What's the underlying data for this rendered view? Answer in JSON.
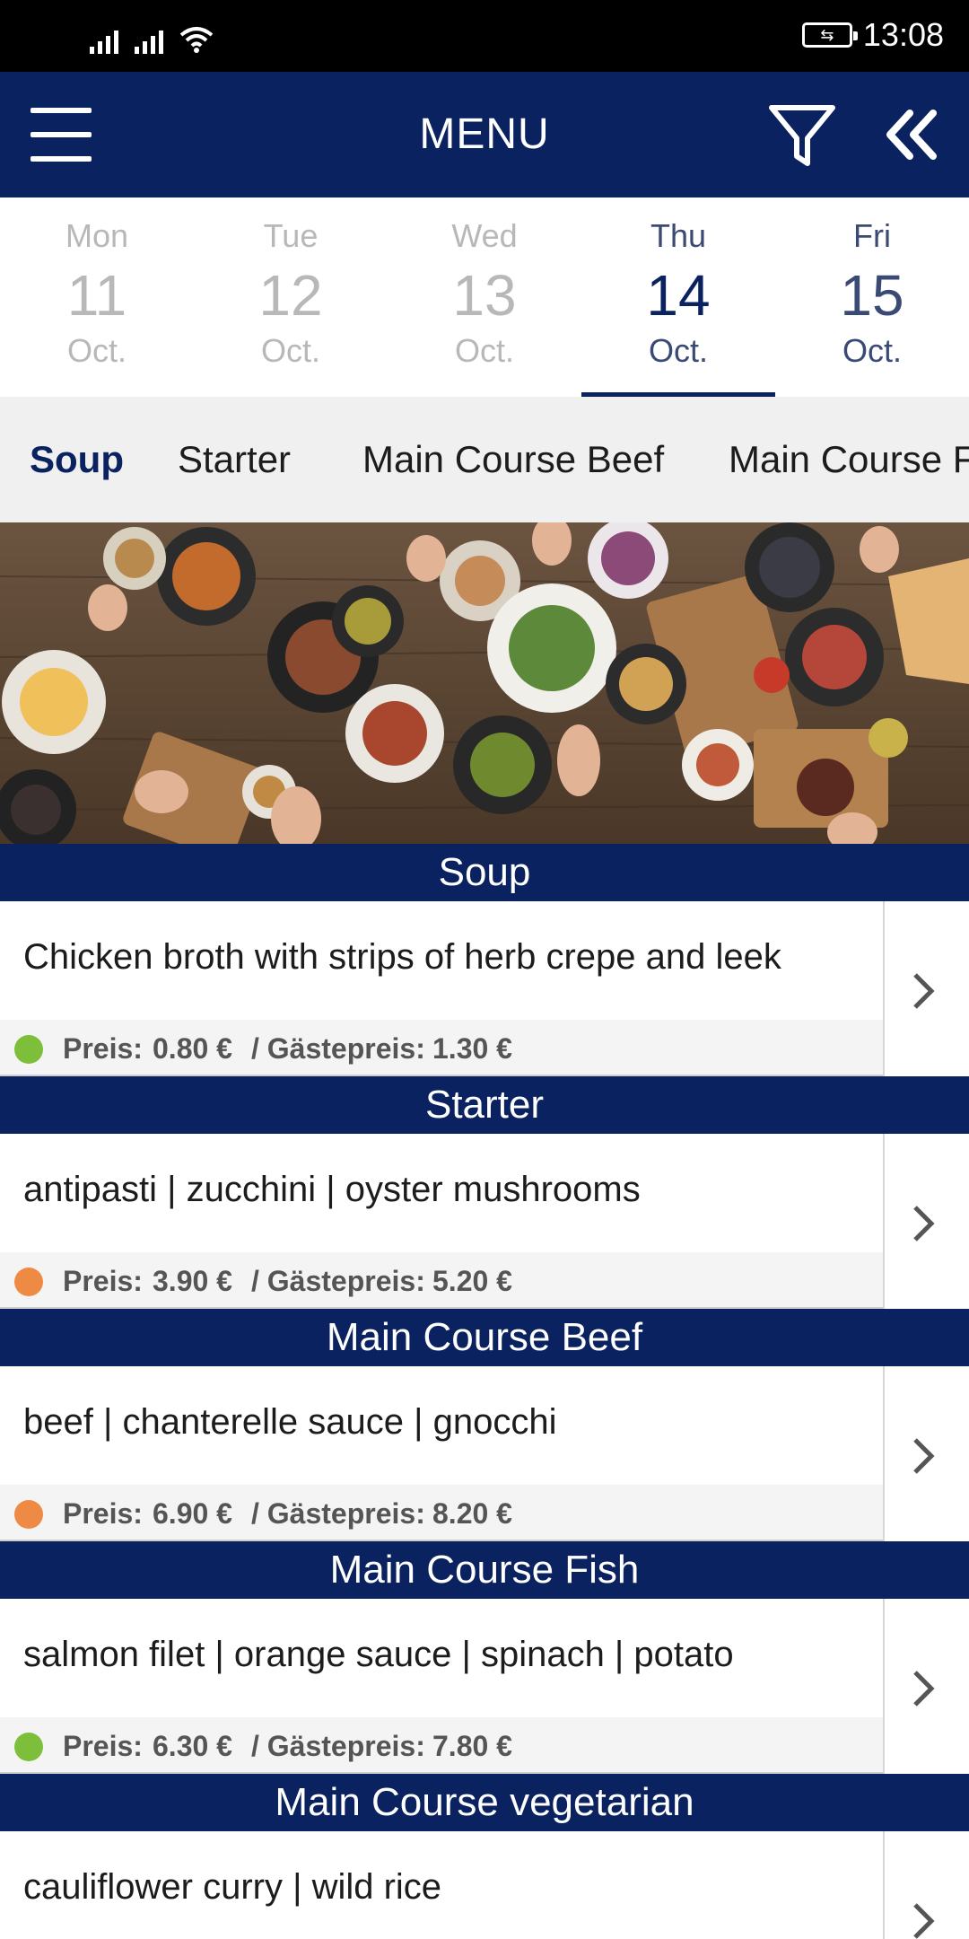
{
  "status_bar": {
    "time": "13:08"
  },
  "header": {
    "title": "MENU"
  },
  "days": [
    {
      "dow": "Mon",
      "num": "11",
      "month": "Oct.",
      "state": "past"
    },
    {
      "dow": "Tue",
      "num": "12",
      "month": "Oct.",
      "state": "past"
    },
    {
      "dow": "Wed",
      "num": "13",
      "month": "Oct.",
      "state": "past"
    },
    {
      "dow": "Thu",
      "num": "14",
      "month": "Oct.",
      "state": "selected"
    },
    {
      "dow": "Fri",
      "num": "15",
      "month": "Oct.",
      "state": "upcoming"
    }
  ],
  "tabs": [
    {
      "label": "Soup",
      "active": true
    },
    {
      "label": "Starter",
      "active": false
    },
    {
      "label": "Main Course Beef",
      "active": false
    },
    {
      "label": "Main Course Fish",
      "active": false
    }
  ],
  "price_labels": {
    "price": "Preis:",
    "guest": "/ Gästepreis:"
  },
  "sections": [
    {
      "title": "Soup",
      "item": {
        "description": "Chicken broth with strips of herb crepe and leek",
        "price": "0.80 €",
        "guest_price": "1.30 €",
        "indicator_color": "#7dbf3a"
      }
    },
    {
      "title": "Starter",
      "item": {
        "description": "antipasti | zucchini | oyster mushrooms",
        "price": "3.90 €",
        "guest_price": "5.20 €",
        "indicator_color": "#ef8a45"
      }
    },
    {
      "title": "Main Course Beef",
      "item": {
        "description": "beef | chanterelle sauce | gnocchi",
        "price": "6.90 €",
        "guest_price": "8.20 €",
        "indicator_color": "#ef8a45"
      }
    },
    {
      "title": "Main Course Fish",
      "item": {
        "description": "salmon filet | orange sauce | spinach | potato",
        "price": "6.30 €",
        "guest_price": "7.80 €",
        "indicator_color": "#7dbf3a"
      }
    },
    {
      "title": "Main Course vegetarian",
      "item": {
        "description": "cauliflower curry | wild rice",
        "price": "",
        "guest_price": "",
        "indicator_color": ""
      }
    }
  ],
  "colors": {
    "brand_navy": "#0b2260",
    "veg_green": "#7dbf3a",
    "meat_orange": "#ef8a45"
  },
  "icons": {
    "menu": "hamburger-icon",
    "filter": "filter-icon",
    "collapse": "double-chevron-left-icon",
    "row_action": "chevron-right-icon"
  }
}
